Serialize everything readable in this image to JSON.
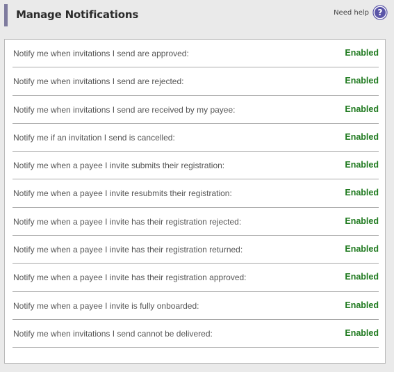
{
  "header": {
    "title": "Manage Notifications",
    "help_label": "Need help",
    "help_icon": "question-circle-icon",
    "accent_color": "#7e7b9e",
    "help_icon_color": "#5a55a8"
  },
  "notifications": {
    "status_color": "#1f7a1f",
    "items": [
      {
        "label": "Notify me when invitations I send are approved:",
        "status": "Enabled"
      },
      {
        "label": "Notify me when invitations I send are rejected:",
        "status": "Enabled"
      },
      {
        "label": "Notify me when invitations I send are received by my payee:",
        "status": "Enabled"
      },
      {
        "label": "Notify me if an invitation I send is cancelled:",
        "status": "Enabled"
      },
      {
        "label": "Notify me when a payee I invite submits their registration:",
        "status": "Enabled"
      },
      {
        "label": "Notify me when a payee I invite resubmits their registration:",
        "status": "Enabled"
      },
      {
        "label": "Notify me when a payee I invite has their registration rejected:",
        "status": "Enabled"
      },
      {
        "label": "Notify me when a payee I invite has their registration returned:",
        "status": "Enabled"
      },
      {
        "label": "Notify me when a payee I invite has their registration approved:",
        "status": "Enabled"
      },
      {
        "label": "Notify me when a payee I invite is fully onboarded:",
        "status": "Enabled"
      },
      {
        "label": "Notify me when invitations I send cannot be delivered:",
        "status": "Enabled"
      }
    ]
  }
}
